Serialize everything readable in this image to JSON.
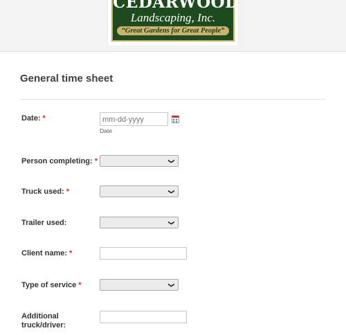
{
  "logo": {
    "title": "CEDARWOOD",
    "subtitle": "Landscaping, Inc.",
    "tagline": "“Great Gardens for Great People”"
  },
  "form": {
    "title": "General time sheet",
    "fields": {
      "date": {
        "label": "Date:",
        "required": "*",
        "placeholder": "mm-dd-yyyy",
        "sublabel": "Date"
      },
      "person": {
        "label": "Person completing:",
        "required": "*"
      },
      "truck": {
        "label": "Truck used:",
        "required": "*"
      },
      "trailer": {
        "label": "Trailer used:"
      },
      "client": {
        "label": "Client name:",
        "required": "*"
      },
      "service": {
        "label": "Type of service",
        "required": "*"
      },
      "additional": {
        "label": "Additional truck/driver:"
      }
    }
  },
  "icons": {
    "dropdown": "chevron-down-icon",
    "calendar": "calendar-icon"
  },
  "colors": {
    "logo_green": "#1e4a1f",
    "logo_gold": "#c8b470",
    "required_red": "#d42a2a"
  }
}
